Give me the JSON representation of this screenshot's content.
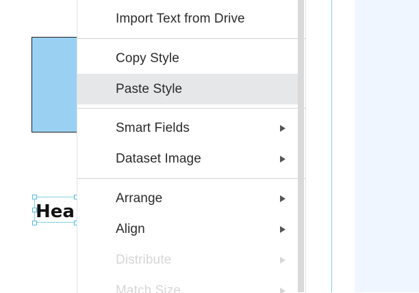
{
  "canvas": {
    "heading_text": "Hea"
  },
  "context_menu": {
    "items": [
      {
        "label": "Import Text from Drive",
        "submenu": false,
        "disabled": false,
        "highlighted": false
      },
      {
        "label": "Copy Style",
        "submenu": false,
        "disabled": false,
        "highlighted": false
      },
      {
        "label": "Paste Style",
        "submenu": false,
        "disabled": false,
        "highlighted": true
      },
      {
        "label": "Smart Fields",
        "submenu": true,
        "disabled": false,
        "highlighted": false
      },
      {
        "label": "Dataset Image",
        "submenu": true,
        "disabled": false,
        "highlighted": false
      },
      {
        "label": "Arrange",
        "submenu": true,
        "disabled": false,
        "highlighted": false
      },
      {
        "label": "Align",
        "submenu": true,
        "disabled": false,
        "highlighted": false
      },
      {
        "label": "Distribute",
        "submenu": true,
        "disabled": true,
        "highlighted": false
      },
      {
        "label": "Match Size",
        "submenu": true,
        "disabled": true,
        "highlighted": false
      }
    ]
  },
  "colors": {
    "selection": "#7fd2e6",
    "shape_fill": "#9ad1f2",
    "highlight": "#e6e7e9",
    "right_panel": "#f0f6ff"
  }
}
